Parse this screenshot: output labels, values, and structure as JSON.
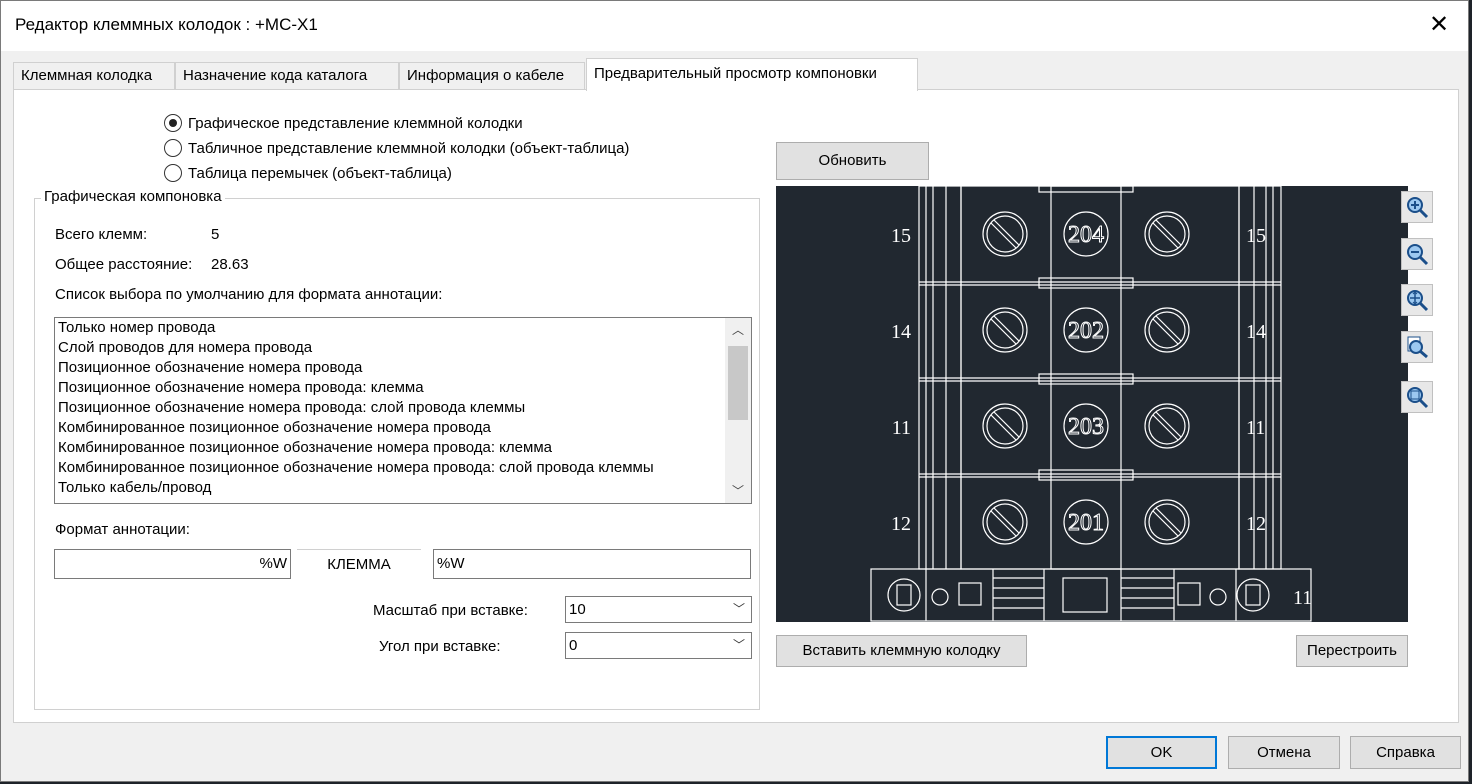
{
  "window": {
    "title": "Редактор клеммных колодок : +MC-X1"
  },
  "tabs": [
    {
      "label": "Клеммная колодка"
    },
    {
      "label": "Назначение кода каталога"
    },
    {
      "label": "Информация о кабеле"
    },
    {
      "label": "Предварительный просмотр компоновки",
      "active": true
    }
  ],
  "radios": [
    {
      "label": "Графическое представление клеммной колодки",
      "selected": true
    },
    {
      "label": "Табличное представление клеммной колодки (объект-таблица)",
      "selected": false
    },
    {
      "label": "Таблица перемычек (объект-таблица)",
      "selected": false
    }
  ],
  "group": {
    "legend": "Графическая компоновка",
    "total_terminals_label": "Всего клемм:",
    "total_terminals_value": "5",
    "total_distance_label": "Общее расстояние:",
    "total_distance_value": "28.63",
    "list_label": "Список выбора по умолчанию для формата аннотации:",
    "list_items": [
      "Только номер провода",
      "Слой проводов для номера провода",
      "Позиционное обозначение номера провода",
      "Позиционное обозначение номера провода: клемма",
      "Позиционное обозначение номера провода: слой провода клеммы",
      "Комбинированное позиционное обозначение номера провода",
      "Комбинированное позиционное обозначение номера провода: клемма",
      "Комбинированное позиционное обозначение номера провода: слой провода клеммы",
      "Только кабель/провод"
    ],
    "format_label": "Формат аннотации:",
    "format_left": "%W",
    "format_middle": "КЛЕММА",
    "format_right": "%W",
    "scale_label": "Масштаб при вставке:",
    "scale_value": "10",
    "angle_label": "Угол при вставке:",
    "angle_value": "0"
  },
  "preview": {
    "refresh_button": "Обновить",
    "rows": [
      {
        "left": "15",
        "center": "204",
        "right": "15"
      },
      {
        "left": "14",
        "center": "202",
        "right": "14"
      },
      {
        "left": "11",
        "center": "203",
        "right": "11"
      },
      {
        "left": "12",
        "center": "201",
        "right": "12"
      }
    ],
    "base_label": "11",
    "insert_button": "Вставить клеммную колодку",
    "rebuild_button": "Перестроить",
    "colors": {
      "background": "#212830",
      "lines": "#ffffff"
    }
  },
  "zoom_tools": [
    {
      "icon": "zoom-in-icon"
    },
    {
      "icon": "zoom-out-icon"
    },
    {
      "icon": "zoom-pan-icon"
    },
    {
      "icon": "zoom-window-icon"
    },
    {
      "icon": "zoom-extents-icon"
    }
  ],
  "footer": {
    "ok_label": "OK",
    "cancel_label": "Отмена",
    "help_label": "Справка"
  }
}
